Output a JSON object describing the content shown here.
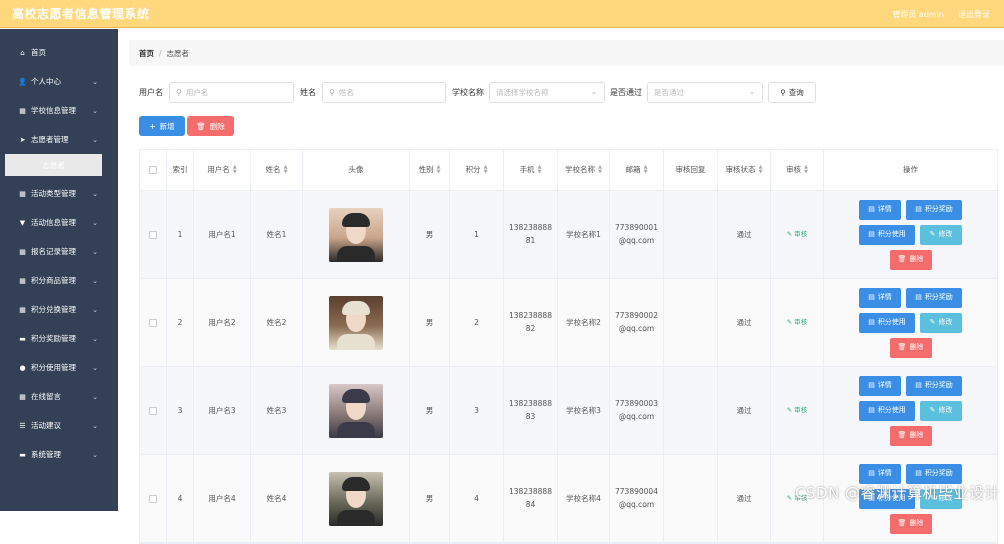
{
  "app": {
    "title": "高校志愿者信息管理系统",
    "admin_label": "管理员 admin",
    "logout": "退出登录"
  },
  "sidebar": {
    "items": [
      {
        "label": "首页",
        "icon": "home-icon",
        "glyph": "⌂",
        "chevron": false
      },
      {
        "label": "个人中心",
        "icon": "user-icon",
        "glyph": "👤",
        "chevron": true
      },
      {
        "label": "学校信息管理",
        "icon": "grid-icon",
        "glyph": "▦",
        "chevron": true
      },
      {
        "label": "志愿者管理",
        "icon": "send-icon",
        "glyph": "➤",
        "chevron": true
      }
    ],
    "active_sub": "志愿者",
    "items2": [
      {
        "label": "活动类型管理",
        "icon": "grid-icon",
        "glyph": "▦",
        "chevron": true
      },
      {
        "label": "活动信息管理",
        "icon": "trophy-icon",
        "glyph": "▼",
        "chevron": true
      },
      {
        "label": "报名记录管理",
        "icon": "grid-icon",
        "glyph": "▦",
        "chevron": true
      },
      {
        "label": "积分商品管理",
        "icon": "grid-icon",
        "glyph": "▦",
        "chevron": true
      },
      {
        "label": "积分兑换管理",
        "icon": "grid-icon",
        "glyph": "▦",
        "chevron": true
      },
      {
        "label": "积分奖励管理",
        "icon": "ticket-icon",
        "glyph": "▬",
        "chevron": true
      },
      {
        "label": "积分使用管理",
        "icon": "bulb-icon",
        "glyph": "●",
        "chevron": true
      },
      {
        "label": "在线留言",
        "icon": "grid-icon",
        "glyph": "▦",
        "chevron": true
      },
      {
        "label": "活动建议",
        "icon": "sliders-icon",
        "glyph": "☰",
        "chevron": true
      },
      {
        "label": "系统管理",
        "icon": "chat-icon",
        "glyph": "▬",
        "chevron": true
      }
    ]
  },
  "breadcrumb": {
    "home": "首页",
    "sep": "/",
    "current": "志愿者"
  },
  "filters": {
    "username_label": "用户名",
    "username_placeholder": "用户名",
    "name_label": "姓名",
    "name_placeholder": "姓名",
    "school_label": "学校名称",
    "school_placeholder": "请选择学校名称",
    "passed_label": "是否通过",
    "passed_placeholder": "是否通过",
    "query": "查询"
  },
  "actions": {
    "add": "新增",
    "delete": "删除"
  },
  "table": {
    "headers": [
      "索引",
      "用户名",
      "姓名",
      "头像",
      "性别",
      "积分",
      "手机",
      "学校名称",
      "邮箱",
      "审核回复",
      "审核状态",
      "审核",
      "操作"
    ],
    "rows": [
      {
        "idx": "1",
        "user": "用户名1",
        "name": "姓名1",
        "gender": "男",
        "points": "1",
        "phone": "13823888881",
        "school": "学校名称1",
        "email": "773890001@qq.com",
        "reply": "",
        "status": "通过",
        "audit": "审核"
      },
      {
        "idx": "2",
        "user": "用户名2",
        "name": "姓名2",
        "gender": "男",
        "points": "2",
        "phone": "13823888882",
        "school": "学校名称2",
        "email": "773890002@qq.com",
        "reply": "",
        "status": "通过",
        "audit": "审核"
      },
      {
        "idx": "3",
        "user": "用户名3",
        "name": "姓名3",
        "gender": "男",
        "points": "3",
        "phone": "13823888883",
        "school": "学校名称3",
        "email": "773890003@qq.com",
        "reply": "",
        "status": "通过",
        "audit": "审核"
      },
      {
        "idx": "4",
        "user": "用户名4",
        "name": "姓名4",
        "gender": "男",
        "points": "4",
        "phone": "13823888884",
        "school": "学校名称4",
        "email": "773890004@qq.com",
        "reply": "",
        "status": "通过",
        "audit": "审核"
      }
    ],
    "ops": {
      "info": "详情",
      "award": "积分奖励",
      "use": "积分使用",
      "edit": "修改",
      "del": "删除"
    }
  },
  "watermark": "CSDN @睿渊计算机毕业设计"
}
